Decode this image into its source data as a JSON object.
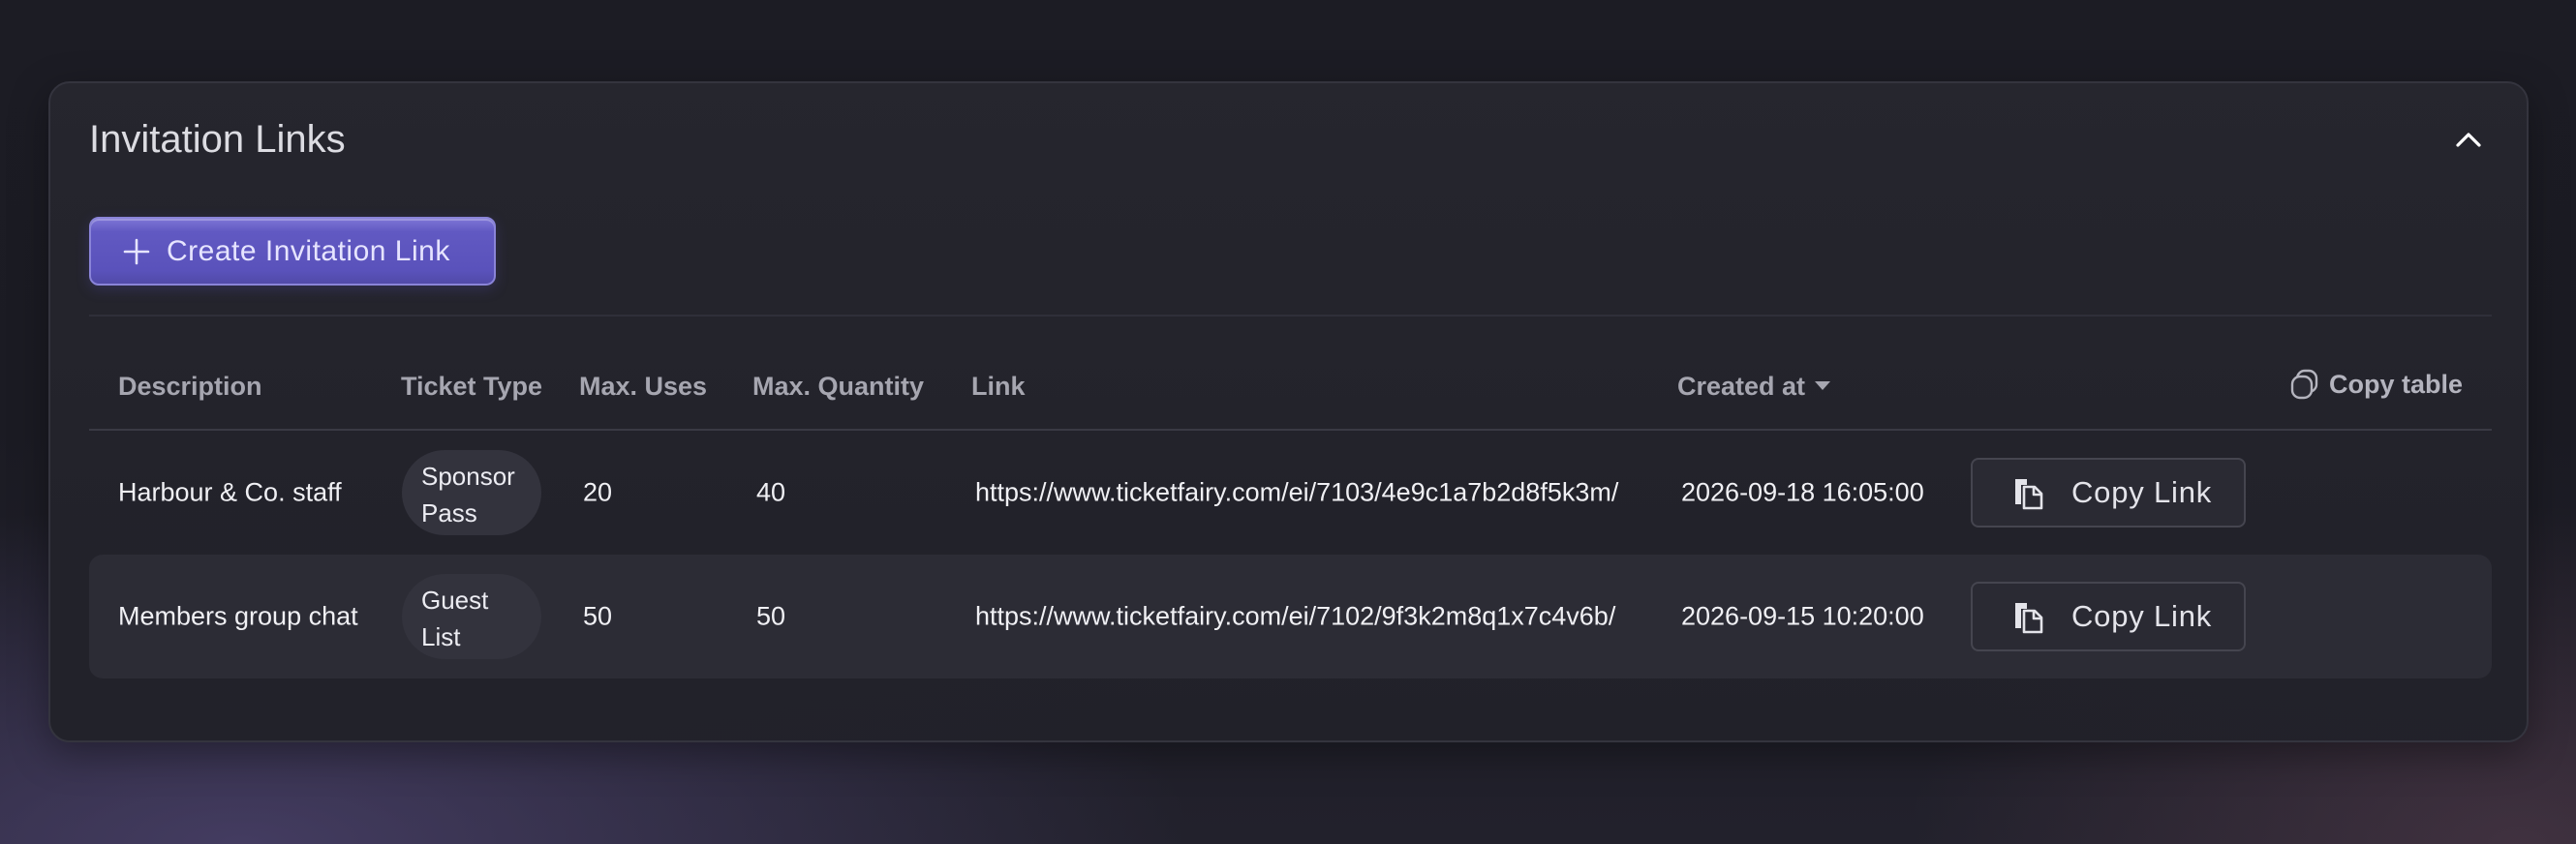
{
  "panel": {
    "title": "Invitation Links",
    "collapse_icon": "chevron-up-icon"
  },
  "create_button": {
    "label": "Create Invitation Link",
    "icon": "plus-icon",
    "color": "#5f58c0"
  },
  "table": {
    "headers": {
      "description": "Description",
      "ticket_type": "Ticket Type",
      "max_uses": "Max. Uses",
      "max_quantity": "Max. Quantity",
      "link": "Link",
      "created_at": "Created at"
    },
    "sort": {
      "column": "created_at",
      "direction": "descending",
      "icon": "caret-down-icon"
    },
    "copy_table": {
      "label": "Copy table",
      "icon": "copy-icon"
    },
    "rows": [
      {
        "description": "Harbour & Co. staff",
        "ticket_type_line1": "Sponsor",
        "ticket_type_line2": "Pass",
        "max_uses": "20",
        "max_quantity": "40",
        "link": "https://www.ticketfairy.com/ei/7103/4e9c1a7b2d8f5k3m/",
        "created_at": "2026-09-18 16:05:00",
        "copy_label": "Copy Link"
      },
      {
        "description": "Members group chat",
        "ticket_type_line1": "Guest",
        "ticket_type_line2": "List",
        "max_uses": "50",
        "max_quantity": "50",
        "link": "https://www.ticketfairy.com/ei/7102/9f3k2m8q1x7c4v6b/",
        "created_at": "2026-09-15 10:20:00",
        "copy_label": "Copy Link"
      }
    ]
  }
}
